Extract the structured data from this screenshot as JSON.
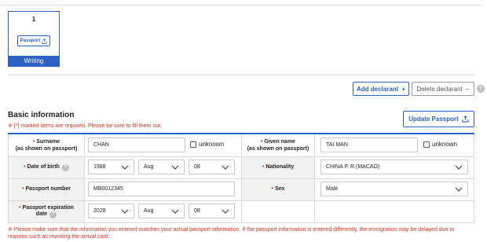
{
  "declarant_card": {
    "number": "1",
    "passport_label": "Passport",
    "status": "Writing"
  },
  "actions": {
    "add_declarant": "Add declarant",
    "add_symbol": "+",
    "delete_declarant": "Delete declarant",
    "delete_symbol": "−",
    "help": "?"
  },
  "section": {
    "title": "Basic information",
    "required_note": "※ [*] marked items are required. Please be sure to fill them out.",
    "update_passport": "Update Passport"
  },
  "form": {
    "required_mark": "•",
    "surname_label_1": "Surname",
    "surname_label_2": "(as shown on passport)",
    "surname_value": "CHAN",
    "surname_unknown": "unknown",
    "given_label_1": "Given name",
    "given_label_2": "(as shown on passport)",
    "given_value": "TAI MAN",
    "given_unknown": "unknown",
    "dob_label": "Date of birth",
    "dob_year": "1988",
    "dob_month": "Aug",
    "dob_day": "08",
    "nationality_label": "Nationality",
    "nationality_value": "CHINA P. R.(MACAO)",
    "passport_number_label": "Passport number",
    "passport_number_value": "MB0012345",
    "sex_label": "Sex",
    "sex_value": "Male",
    "expiry_label_1": "Passport expiration",
    "expiry_label_2": "date",
    "expiry_year": "2028",
    "expiry_month": "Aug",
    "expiry_day": "08",
    "help": "?"
  },
  "footer_note": "※ Please make sure that the information you entered matches your actual passport information. If the passport information is entered differently, the immigration may be delayed due to reasons such as rewriting the arrival card.",
  "colors": {
    "accent": "#2c62c4",
    "required": "#e0301e",
    "label_bg": "#f2f2f2"
  }
}
